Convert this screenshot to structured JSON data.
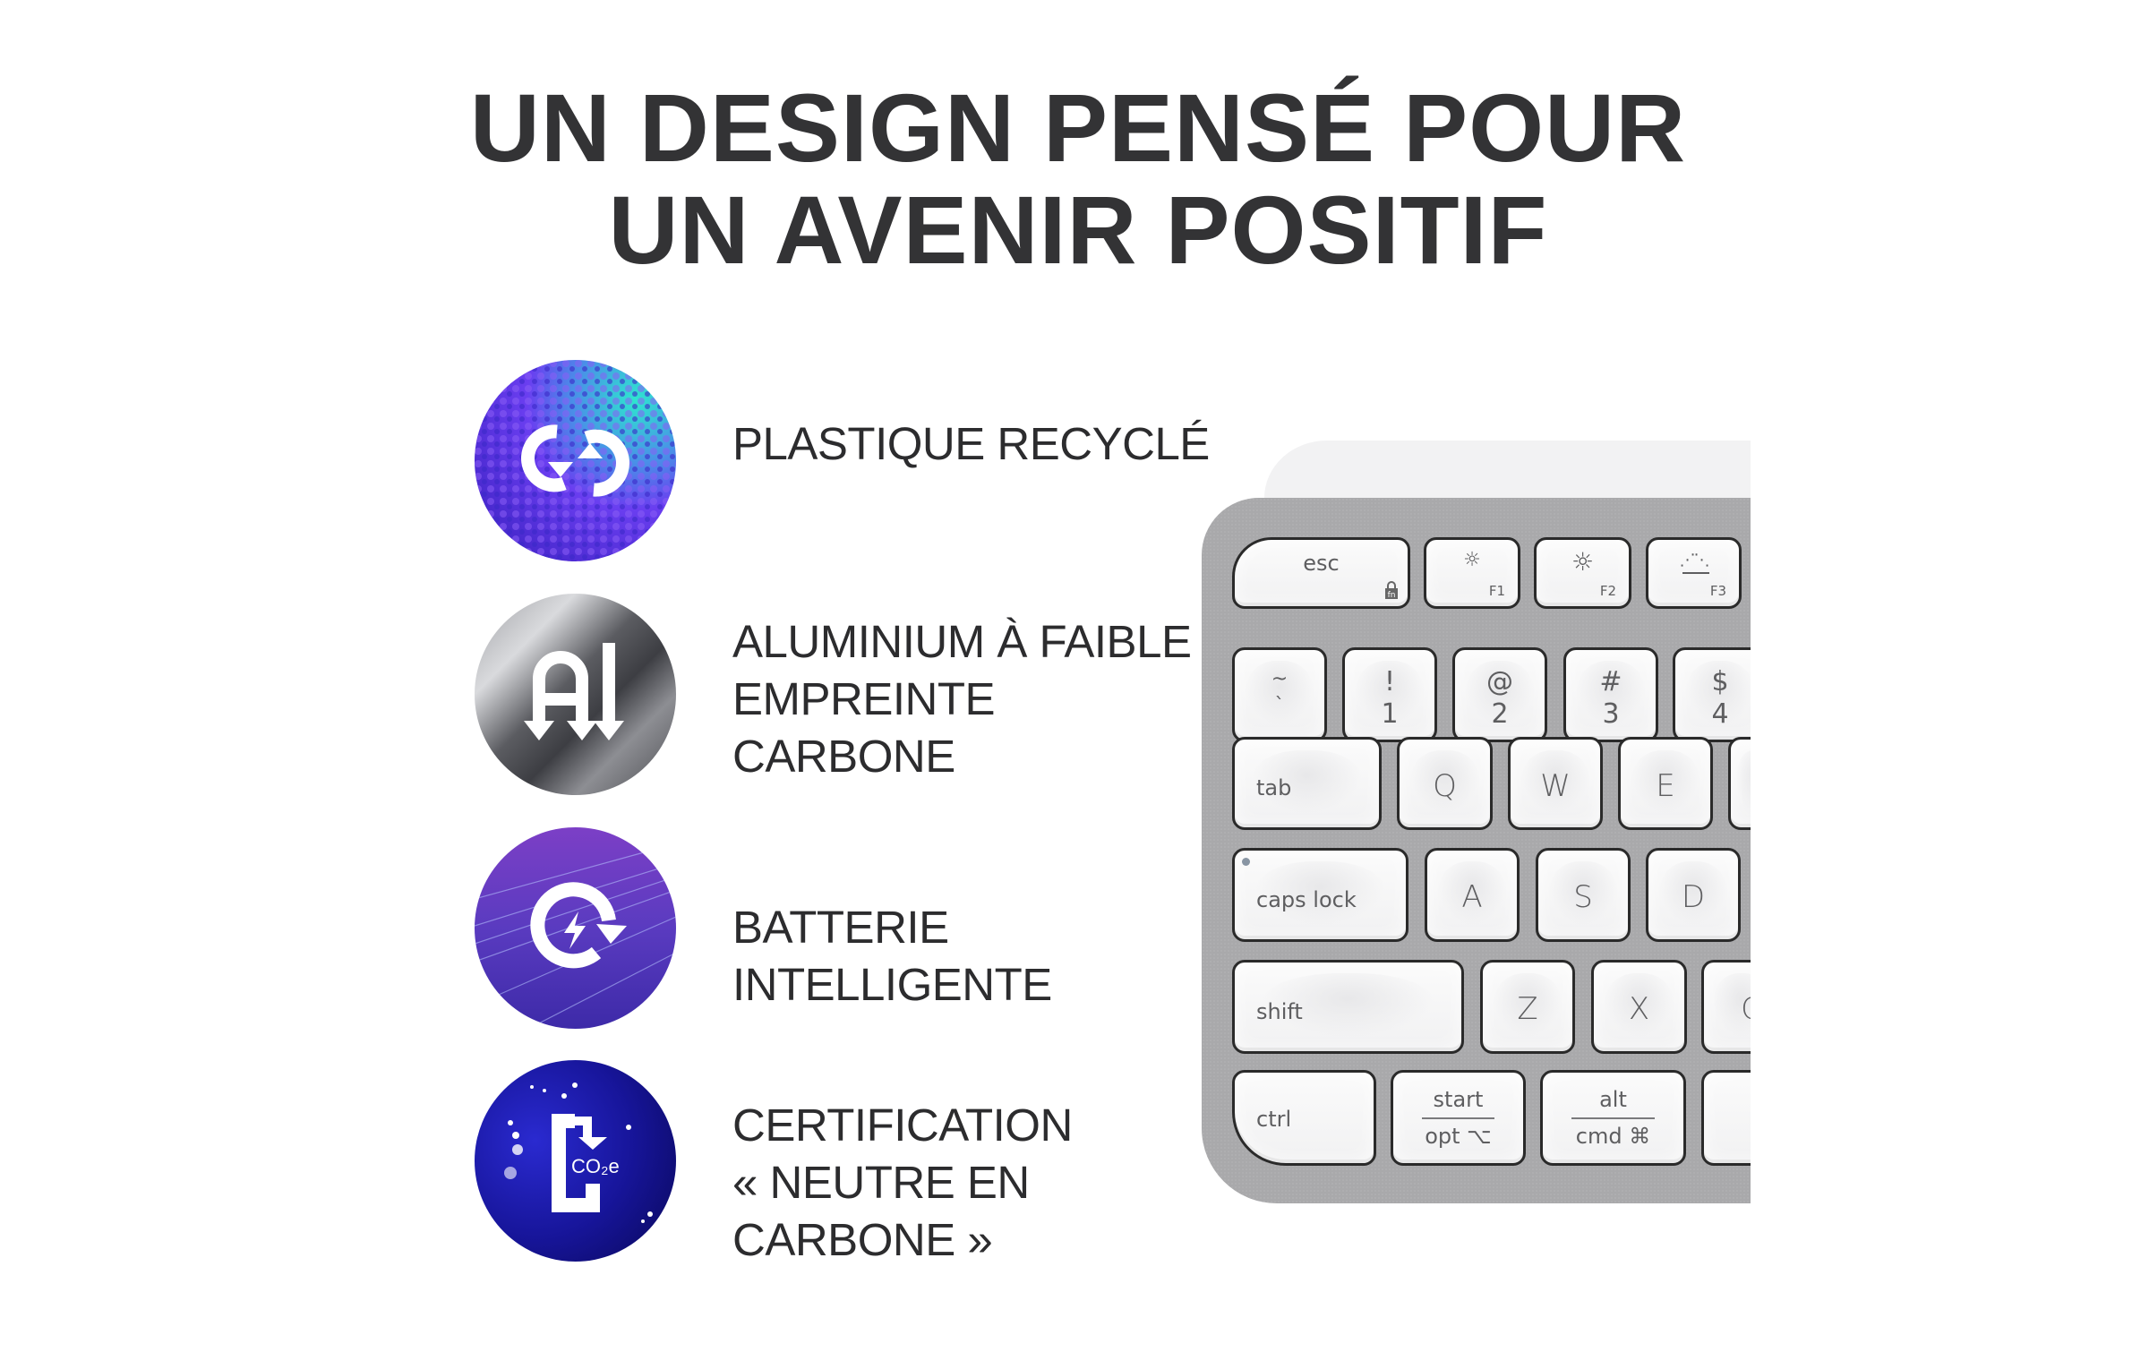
{
  "heading": {
    "line1": "UN DESIGN PENSÉ POUR",
    "line2": "UN AVENIR POSITIF"
  },
  "features": [
    {
      "icon": "recycle-arrows-icon",
      "lines": [
        "PLASTIQUE RECYCLÉ"
      ]
    },
    {
      "icon": "aluminium-low-carbon-icon",
      "icon_text": "Al",
      "lines": [
        "ALUMINIUM À FAIBLE",
        "EMPREINTE",
        "CARBONE"
      ]
    },
    {
      "icon": "smart-battery-icon",
      "lines": [
        "BATTERIE",
        "INTELLIGENTE"
      ]
    },
    {
      "icon": "carbon-neutral-icon",
      "icon_text": "CO₂e",
      "lines": [
        "CERTIFICATION",
        "« NEUTRE EN",
        "CARBONE »"
      ]
    }
  ],
  "colors": {
    "heading": "#333335",
    "text": "#2c2c2e",
    "keyboard_body": "#a9a9ab",
    "key": "#f7f7f8",
    "recycle_bg": "#5a35e0",
    "recycle_accent": "#27e3d0",
    "aluminium_bg": "#6c6d72",
    "battery_bg": "#5a3bc0",
    "carbon_bg": "#14128a"
  },
  "keyboard": {
    "row1": {
      "esc": "esc",
      "esc_sub": "fn",
      "f1": "F1",
      "f2": "F2",
      "f3": "F3"
    },
    "row2": [
      {
        "top": "~",
        "bottom": "`"
      },
      {
        "top": "!",
        "bottom": "1"
      },
      {
        "top": "@",
        "bottom": "2"
      },
      {
        "top": "#",
        "bottom": "3"
      },
      {
        "top": "$",
        "bottom": "4"
      }
    ],
    "row3": {
      "tab": "tab",
      "keys": [
        "Q",
        "W",
        "E"
      ]
    },
    "row4": {
      "caps": "caps lock",
      "keys": [
        "A",
        "S",
        "D"
      ]
    },
    "row5": {
      "shift": "shift",
      "keys": [
        "Z",
        "X",
        "C"
      ]
    },
    "row6": {
      "ctrl": "ctrl",
      "opt_top": "start",
      "opt_bottom": "opt ⌥",
      "cmd_top": "alt",
      "cmd_bottom": "cmd ⌘"
    }
  }
}
